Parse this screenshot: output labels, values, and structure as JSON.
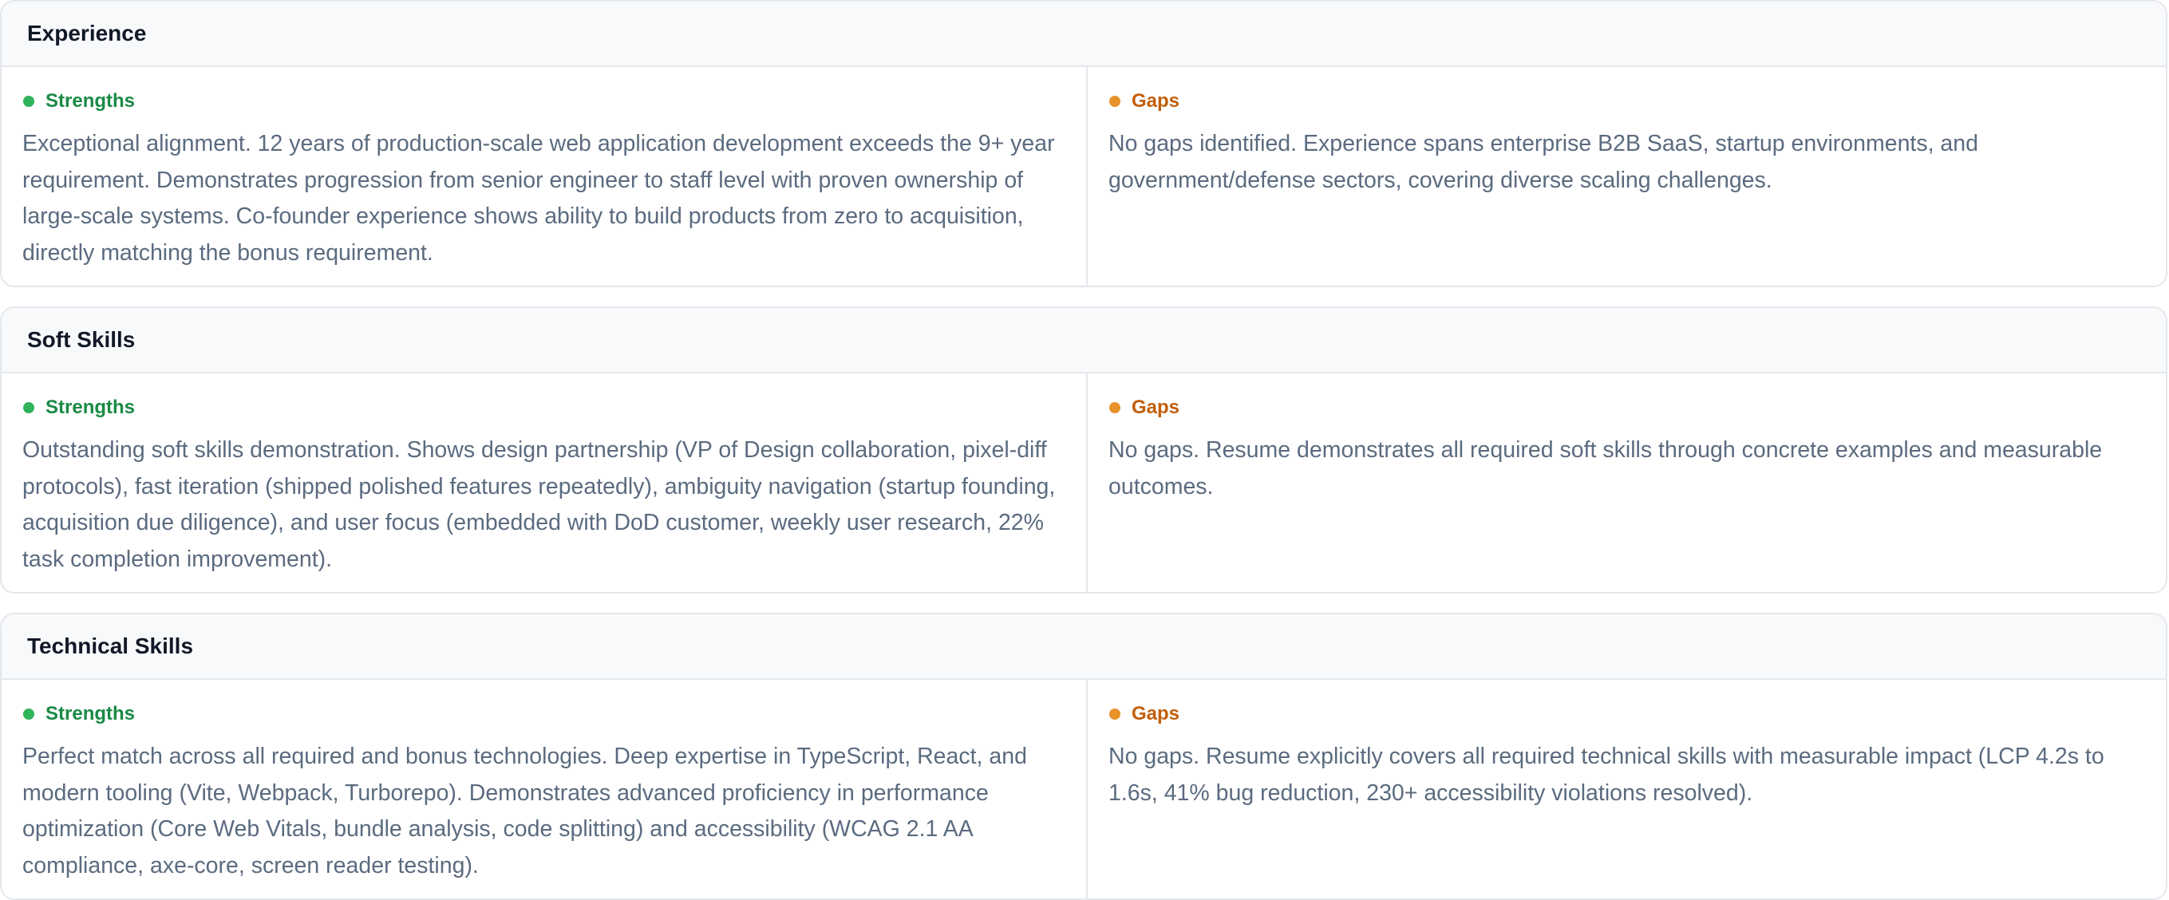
{
  "sections": [
    {
      "title": "Experience",
      "strengths_label": "Strengths",
      "strengths_text": "Exceptional alignment. 12 years of production-scale web application development exceeds the 9+ year requirement. Demonstrates progression from senior engineer to staff level with proven ownership of large-scale systems. Co-founder experience shows ability to build products from zero to acquisition, directly matching the bonus requirement.",
      "gaps_label": "Gaps",
      "gaps_text": "No gaps identified. Experience spans enterprise B2B SaaS, startup environments, and government/defense sectors, covering diverse scaling challenges."
    },
    {
      "title": "Soft Skills",
      "strengths_label": "Strengths",
      "strengths_text": "Outstanding soft skills demonstration. Shows design partnership (VP of Design collaboration, pixel-diff protocols), fast iteration (shipped polished features repeatedly), ambiguity navigation (startup founding, acquisition due diligence), and user focus (embedded with DoD customer, weekly user research, 22% task completion improvement).",
      "gaps_label": "Gaps",
      "gaps_text": "No gaps. Resume demonstrates all required soft skills through concrete examples and measurable outcomes."
    },
    {
      "title": "Technical Skills",
      "strengths_label": "Strengths",
      "strengths_text": "Perfect match across all required and bonus technologies. Deep expertise in TypeScript, React, and modern tooling (Vite, Webpack, Turborepo). Demonstrates advanced proficiency in performance optimization (Core Web Vitals, bundle analysis, code splitting) and accessibility (WCAG 2.1 AA compliance, axe-core, screen reader testing).",
      "gaps_label": "Gaps",
      "gaps_text": "No gaps. Resume explicitly covers all required technical skills with measurable impact (LCP 4.2s to 1.6s, 41% bug reduction, 230+ accessibility violations resolved)."
    }
  ],
  "colors": {
    "strengths": "#2fb45a",
    "gaps": "#e8922a"
  }
}
